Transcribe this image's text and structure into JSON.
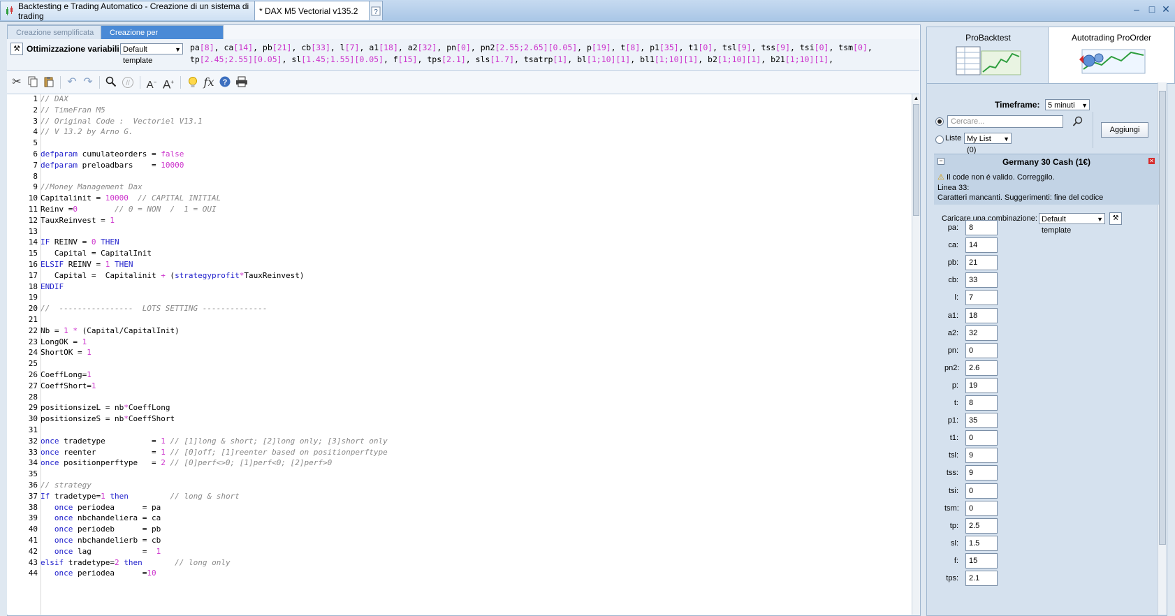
{
  "window": {
    "tab1": "Backtesting e Trading Automatico - Creazione di un sistema di trading",
    "tab2": "* DAX M5 Vectorial v135.2"
  },
  "mode_tabs": [
    "Creazione semplificata",
    "Creazione per programmazione"
  ],
  "optimization": {
    "label": "Ottimizzazione variabili:",
    "template": "Default template",
    "vars_line1": [
      [
        "pa",
        "[8]"
      ],
      [
        "ca",
        "[14]"
      ],
      [
        "pb",
        "[21]"
      ],
      [
        "cb",
        "[33]"
      ],
      [
        "l",
        "[7]"
      ],
      [
        "a1",
        "[18]"
      ],
      [
        "a2",
        "[32]"
      ],
      [
        "pn",
        "[0]"
      ],
      [
        "pn2",
        "[2.55;2.65][0.05]"
      ],
      [
        "p",
        "[19]"
      ],
      [
        "t",
        "[8]"
      ],
      [
        "p1",
        "[35]"
      ],
      [
        "t1",
        "[0]"
      ],
      [
        "tsl",
        "[9]"
      ],
      [
        "tss",
        "[9]"
      ],
      [
        "tsi",
        "[0]"
      ],
      [
        "tsm",
        "[0]"
      ]
    ],
    "vars_line2": [
      [
        "tp",
        "[2.45;2.55][0.05]"
      ],
      [
        "sl",
        "[1.45;1.55][0.05]"
      ],
      [
        "f",
        "[15]"
      ],
      [
        "tps",
        "[2.1]"
      ],
      [
        "sls",
        "[1.7]"
      ],
      [
        "tsatrp",
        "[1]"
      ],
      [
        "bl",
        "[1;10][1]"
      ],
      [
        "bl1",
        "[1;10][1]"
      ],
      [
        "b2",
        "[1;10][1]"
      ],
      [
        "b21",
        "[1;10][1]"
      ]
    ]
  },
  "toolbar_icons": [
    "cut-icon",
    "copy-icon",
    "paste-icon",
    "undo-icon",
    "redo-icon",
    "search-icon",
    "comment-icon",
    "font-decrease-icon",
    "font-increase-icon",
    "bulb-icon",
    "function-icon",
    "help-icon",
    "print-icon"
  ],
  "code": [
    [
      [
        "cm",
        "// DAX"
      ]
    ],
    [
      [
        "cm",
        "// TimeFran M5"
      ]
    ],
    [
      [
        "cm",
        "// Original Code :  Vectoriel V13.1"
      ]
    ],
    [
      [
        "cm",
        "// V 13.2 by Arno G."
      ]
    ],
    [],
    [
      [
        "kw",
        "defparam"
      ],
      [
        "t",
        " cumulateorders = "
      ],
      [
        "fa",
        "false"
      ]
    ],
    [
      [
        "kw",
        "defparam"
      ],
      [
        "t",
        " preloadbars    = "
      ],
      [
        "nu",
        "10000"
      ]
    ],
    [],
    [
      [
        "cm",
        "//Money Management Dax"
      ]
    ],
    [
      [
        "t",
        "Capitalinit = "
      ],
      [
        "nu",
        "10000"
      ],
      [
        "t",
        "  "
      ],
      [
        "cm",
        "// CAPITAL INITIAL"
      ]
    ],
    [
      [
        "t",
        "Reinv ="
      ],
      [
        "nu",
        "0"
      ],
      [
        "t",
        "        "
      ],
      [
        "cm",
        "// 0 = NON  /  1 = OUI"
      ]
    ],
    [
      [
        "t",
        "TauxReinvest = "
      ],
      [
        "nu",
        "1"
      ]
    ],
    [],
    [
      [
        "kw",
        "IF"
      ],
      [
        "t",
        " REINV = "
      ],
      [
        "nu",
        "0"
      ],
      [
        "t",
        " "
      ],
      [
        "kw",
        "THEN"
      ]
    ],
    [
      [
        "t",
        "   Capital = CapitalInit"
      ]
    ],
    [
      [
        "kw",
        "ELSIF"
      ],
      [
        "t",
        " REINV = "
      ],
      [
        "nu",
        "1"
      ],
      [
        "t",
        " "
      ],
      [
        "kw",
        "THEN"
      ]
    ],
    [
      [
        "t",
        "   Capital =  Capitalinit "
      ],
      [
        "op",
        "+"
      ],
      [
        "t",
        " ("
      ],
      [
        "fn",
        "strategyprofit"
      ],
      [
        "op",
        "*"
      ],
      [
        "t",
        "TauxReinvest)"
      ]
    ],
    [
      [
        "kw",
        "ENDIF"
      ]
    ],
    [],
    [
      [
        "cm",
        "//  ----------------  LOTS SETTING --------------"
      ]
    ],
    [],
    [
      [
        "t",
        "Nb = "
      ],
      [
        "nu",
        "1"
      ],
      [
        "t",
        " "
      ],
      [
        "op",
        "*"
      ],
      [
        "t",
        " (Capital/CapitalInit)"
      ]
    ],
    [
      [
        "t",
        "LongOK = "
      ],
      [
        "nu",
        "1"
      ]
    ],
    [
      [
        "t",
        "ShortOK = "
      ],
      [
        "nu",
        "1"
      ]
    ],
    [],
    [
      [
        "t",
        "CoeffLong="
      ],
      [
        "nu",
        "1"
      ]
    ],
    [
      [
        "t",
        "CoeffShort="
      ],
      [
        "nu",
        "1"
      ]
    ],
    [],
    [
      [
        "t",
        "positionsizeL = nb"
      ],
      [
        "op",
        "*"
      ],
      [
        "t",
        "CoeffLong"
      ]
    ],
    [
      [
        "t",
        "positionsizeS = nb"
      ],
      [
        "op",
        "*"
      ],
      [
        "t",
        "CoeffShort"
      ]
    ],
    [],
    [
      [
        "kw",
        "once"
      ],
      [
        "t",
        " tradetype          = "
      ],
      [
        "nu",
        "1"
      ],
      [
        "t",
        " "
      ],
      [
        "cm",
        "// [1]long & short; [2]long only; [3]short only"
      ]
    ],
    [
      [
        "kw",
        "once"
      ],
      [
        "t",
        " reenter            = "
      ],
      [
        "nu",
        "1"
      ],
      [
        "t",
        " "
      ],
      [
        "cm",
        "// [0]off; [1]reenter based on positionperftype"
      ]
    ],
    [
      [
        "kw",
        "once"
      ],
      [
        "t",
        " positionperftype   = "
      ],
      [
        "nu",
        "2"
      ],
      [
        "t",
        " "
      ],
      [
        "cm",
        "// [0]perf<>0; [1]perf<0; [2]perf>0"
      ]
    ],
    [],
    [
      [
        "cm",
        "// strategy"
      ]
    ],
    [
      [
        "kw",
        "If"
      ],
      [
        "t",
        " tradetype="
      ],
      [
        "nu",
        "1"
      ],
      [
        "t",
        " "
      ],
      [
        "kw",
        "then"
      ],
      [
        "t",
        "         "
      ],
      [
        "cm",
        "// long & short"
      ]
    ],
    [
      [
        "t",
        "   "
      ],
      [
        "kw",
        "once"
      ],
      [
        "t",
        " periodea      = pa"
      ]
    ],
    [
      [
        "t",
        "   "
      ],
      [
        "kw",
        "once"
      ],
      [
        "t",
        " nbchandeliera = ca"
      ]
    ],
    [
      [
        "t",
        "   "
      ],
      [
        "kw",
        "once"
      ],
      [
        "t",
        " periodeb      = pb"
      ]
    ],
    [
      [
        "t",
        "   "
      ],
      [
        "kw",
        "once"
      ],
      [
        "t",
        " nbchandelierb = cb"
      ]
    ],
    [
      [
        "t",
        "   "
      ],
      [
        "kw",
        "once"
      ],
      [
        "t",
        " lag           =  "
      ],
      [
        "nu",
        "1"
      ]
    ],
    [
      [
        "kw",
        "elsif"
      ],
      [
        "t",
        " tradetype="
      ],
      [
        "nu",
        "2"
      ],
      [
        "t",
        " "
      ],
      [
        "kw",
        "then"
      ],
      [
        "t",
        "       "
      ],
      [
        "cm",
        "// long only"
      ]
    ],
    [
      [
        "t",
        "   "
      ],
      [
        "kw",
        "once"
      ],
      [
        "t",
        " periodea      ="
      ],
      [
        "nu",
        "10"
      ]
    ]
  ],
  "right_panel": {
    "tab1": "ProBacktest",
    "tab2": "Autotrading ProOrder",
    "timeframe_label": "Timeframe:",
    "timeframe_value": "5 minuti",
    "search_placeholder": "Cercare...",
    "add_button": "Aggiungi",
    "list_label": "Liste",
    "list_value": "My List (0)",
    "instrument": "Germany 30 Cash (1€)",
    "error1": "Il code non é valido. Correggilo.",
    "error2": "Linea 33:",
    "error3": "Caratteri mancanti. Suggerimenti: fine del codice",
    "combo_label": "Caricare una combinazione:",
    "combo_value": "Default template",
    "params": [
      {
        "label": "pa:",
        "value": "8"
      },
      {
        "label": "ca:",
        "value": "14"
      },
      {
        "label": "pb:",
        "value": "21"
      },
      {
        "label": "cb:",
        "value": "33"
      },
      {
        "label": "l:",
        "value": "7"
      },
      {
        "label": "a1:",
        "value": "18"
      },
      {
        "label": "a2:",
        "value": "32"
      },
      {
        "label": "pn:",
        "value": "0"
      },
      {
        "label": "pn2:",
        "value": "2.6"
      },
      {
        "label": "p:",
        "value": "19"
      },
      {
        "label": "t:",
        "value": "8"
      },
      {
        "label": "p1:",
        "value": "35"
      },
      {
        "label": "t1:",
        "value": "0"
      },
      {
        "label": "tsl:",
        "value": "9"
      },
      {
        "label": "tss:",
        "value": "9"
      },
      {
        "label": "tsi:",
        "value": "0"
      },
      {
        "label": "tsm:",
        "value": "0"
      },
      {
        "label": "tp:",
        "value": "2.5"
      },
      {
        "label": "sl:",
        "value": "1.5"
      },
      {
        "label": "f:",
        "value": "15"
      },
      {
        "label": "tps:",
        "value": "2.1"
      }
    ]
  }
}
